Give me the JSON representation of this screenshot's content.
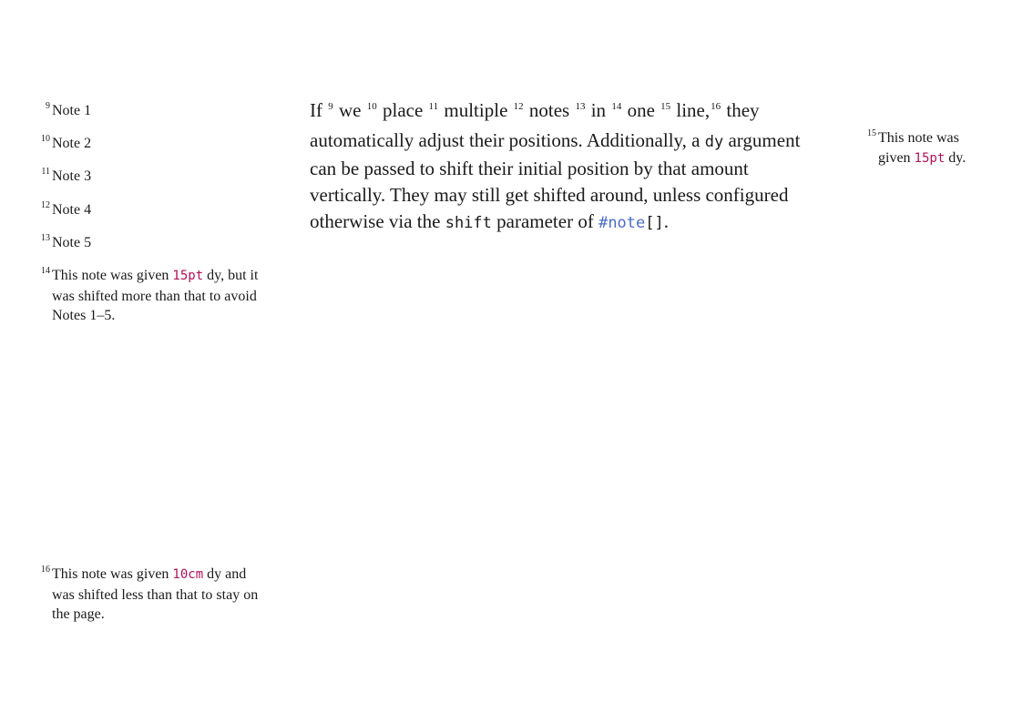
{
  "body": {
    "s1": "If",
    "m9": "9",
    "s2": "we",
    "m10": "10",
    "s3": "place",
    "m11": "11",
    "s4": "multiple",
    "m12": "12",
    "s5": "notes",
    "m13": "13",
    "s6": "in",
    "m14": "14",
    "s7": "one",
    "m15": "15",
    "s8": "line,",
    "m16": "16",
    "s9": "they automatically adjust their positions. Additionally, a",
    "code_dy": "dy",
    "s10": "argument can be passed to shift their initial position by that amount vertically. They may still get shifted around, unless configured otherwise via the",
    "code_shift": "shift",
    "s11": "parameter of",
    "link_note": "#note",
    "brackets": "[]",
    "s12": "."
  },
  "notes": [
    {
      "num": "9",
      "text": "Note 1"
    },
    {
      "num": "10",
      "text": "Note 2"
    },
    {
      "num": "11",
      "text": "Note 3"
    },
    {
      "num": "12",
      "text": "Note 4"
    },
    {
      "num": "13",
      "text": "Note 5"
    },
    {
      "num": "14",
      "pre": "This note was given",
      "code": "15pt",
      "post": "dy, but it was shifted more than that to avoid Notes 1–5."
    },
    {
      "num": "15",
      "pre": "This note was given",
      "code": "15pt",
      "post": "dy."
    },
    {
      "num": "16",
      "pre": "This note was given",
      "code": "10cm",
      "post": "dy and was shifted less than that to stay on the page."
    }
  ],
  "colors": {
    "code": "#b3105a",
    "link": "#4b6cc8",
    "text": "#1a1a1a"
  }
}
